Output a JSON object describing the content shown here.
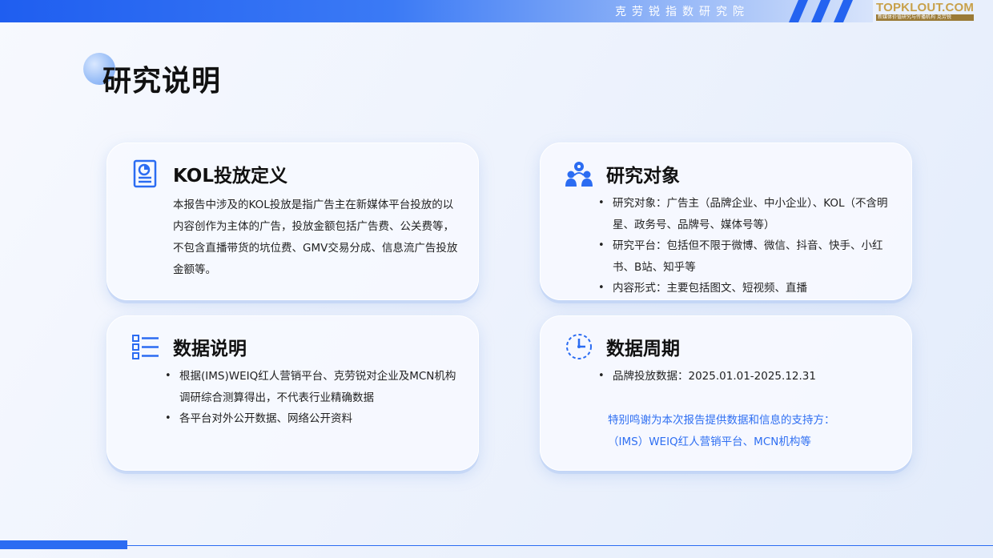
{
  "header": {
    "institute": "克劳锐指数研究院",
    "logo_text": "TOPKLOUT.COM",
    "logo_subtext": "新媒体价值研究与传播机构 克劳锐"
  },
  "page": {
    "title": "研究说明"
  },
  "cards": {
    "kol_definition": {
      "icon": "report-document-icon",
      "title": "KOL投放定义",
      "body": "本报告中涉及的KOL投放是指广告主在新媒体平台投放的以内容创作为主体的广告，投放金额包括广告费、公关费等，不包含直播带货的坑位费、GMV交易分成、信息流广告投放金额等。"
    },
    "research_subject": {
      "icon": "people-group-icon",
      "title": "研究对象",
      "items": [
        "研究对象：广告主（品牌企业、中小企业）、KOL（不含明星、政务号、品牌号、媒体号等）",
        "研究平台：包括但不限于微博、微信、抖音、快手、小红书、B站、知乎等",
        "内容形式：主要包括图文、短视频、直播"
      ]
    },
    "data_description": {
      "icon": "list-checklist-icon",
      "title": "数据说明",
      "items": [
        "根据(IMS)WEIQ红人营销平台、克劳锐对企业及MCN机构调研综合测算得出，不代表行业精确数据",
        "各平台对外公开数据、网络公开资料"
      ]
    },
    "data_period": {
      "icon": "clock-icon",
      "title": "数据周期",
      "items": [
        "品牌投放数据：2025.01.01-2025.12.31"
      ],
      "thanks_line1": "特别鸣谢为本次报告提供数据和信息的支持方：",
      "thanks_line2": "（IMS）WEIQ红人营销平台、MCN机构等"
    }
  },
  "colors": {
    "accent": "#2b6cf2",
    "highlight_text": "#2f6ff2",
    "logo_gold": "#c8a14a"
  }
}
